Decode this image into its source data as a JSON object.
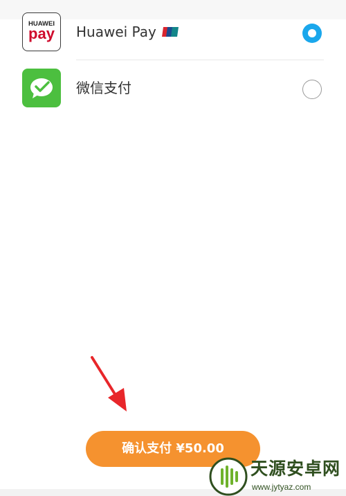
{
  "payment_methods": [
    {
      "name": "Huawei Pay",
      "icon": "huawei-pay-icon",
      "icon_text_top": "HUAWEI",
      "icon_text_bottom": "pay",
      "badge": "unionpay-icon",
      "selected": true
    },
    {
      "name": "微信支付",
      "icon": "wechat-pay-icon",
      "selected": false
    }
  ],
  "confirm_button": {
    "label": "确认支付 ¥50.00"
  },
  "watermark": {
    "title": "天源安卓网",
    "url": "www.jytyaz.com"
  },
  "colors": {
    "radio_selected": "#1aa7ec",
    "confirm_button": "#f5922f",
    "wechat_green": "#4cbf3f",
    "huawei_red": "#cf0a2c",
    "arrow": "#e8262a"
  }
}
